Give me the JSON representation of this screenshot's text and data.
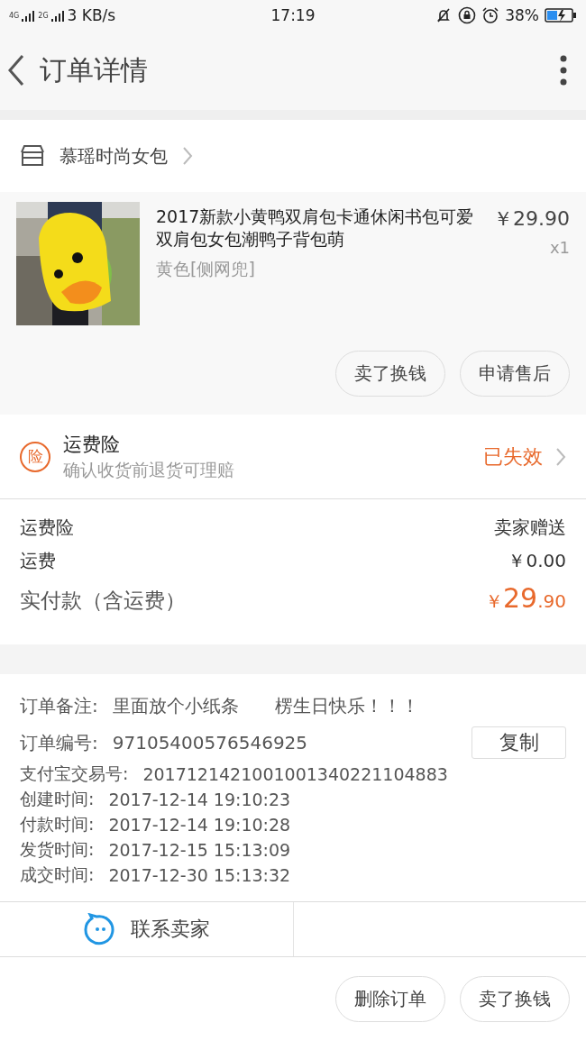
{
  "status_bar": {
    "network_1": "4G",
    "network_2": "2G",
    "speed": "3 KB/s",
    "time": "17:19",
    "battery": "38%"
  },
  "header": {
    "title": "订单详情"
  },
  "shop": {
    "name": "慕瑶时尚女包"
  },
  "product": {
    "kind": "picture",
    "title": "2017新款小黄鸭双肩包卡通休闲书包可爱双肩包女包潮鸭子背包萌",
    "variant": "黄色[侧网兜]",
    "price": "￥29.90",
    "quantity": "x1",
    "buttons": [
      "卖了换钱",
      "申请售后"
    ]
  },
  "insurance": {
    "badge": "险",
    "title": "运费险",
    "subtitle": "确认收货前退货可理赔",
    "status": "已失效"
  },
  "fees": [
    {
      "label": "运费险",
      "value": "卖家赠送"
    },
    {
      "label": "运费",
      "value": "￥0.00"
    }
  ],
  "total": {
    "label": "实付款（含运费）",
    "currency": "￥",
    "integer": "29",
    "decimal": ".90"
  },
  "info": [
    {
      "label": "订单备注:",
      "value": "里面放个小纸条　　楞生日快乐！！！"
    },
    {
      "label": "订单编号:",
      "value": "97105400576546925"
    },
    {
      "label": "支付宝交易号:",
      "value": "2017121421001001340221104883"
    },
    {
      "label": "创建时间:",
      "value": "2017-12-14 19:10:23"
    },
    {
      "label": "付款时间:",
      "value": "2017-12-14 19:10:28"
    },
    {
      "label": "发货时间:",
      "value": "2017-12-15 15:13:09"
    },
    {
      "label": "成交时间:",
      "value": "2017-12-30 15:13:32"
    }
  ],
  "copy_button": "复制",
  "contact": "联系卖家",
  "bottom_buttons": [
    "删除订单",
    "卖了换钱"
  ]
}
